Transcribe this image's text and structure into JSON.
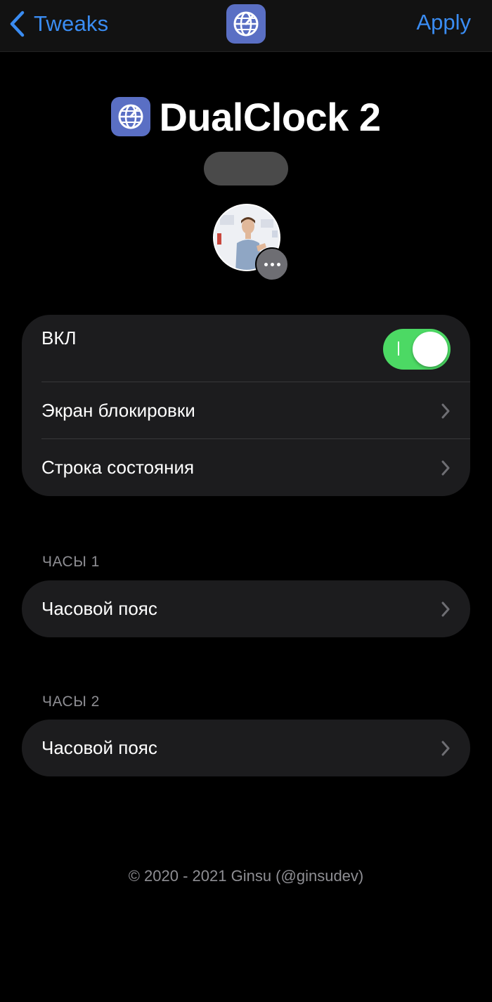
{
  "navbar": {
    "back_label": "Tweaks",
    "apply_label": "Apply",
    "icon": "globe-clock-icon"
  },
  "header": {
    "title": "DualClock 2",
    "icon": "globe-clock-icon"
  },
  "colors": {
    "accent": "#3a8cf2",
    "toggle_on": "#4cd964",
    "app_icon_bg": "#5a6fc4",
    "group_bg": "#1c1c1e",
    "secondary_text": "#8e8e93"
  },
  "main_group": {
    "enabled_label": "ВКЛ",
    "enabled": true,
    "lock_screen_label": "Экран блокировки",
    "status_bar_label": "Строка состояния"
  },
  "clock1": {
    "header": "ЧАСЫ 1",
    "timezone_label": "Часовой пояс"
  },
  "clock2": {
    "header": "ЧАСЫ 2",
    "timezone_label": "Часовой пояс"
  },
  "footer": {
    "copyright": "© 2020 - 2021 Ginsu (@ginsudev)"
  }
}
